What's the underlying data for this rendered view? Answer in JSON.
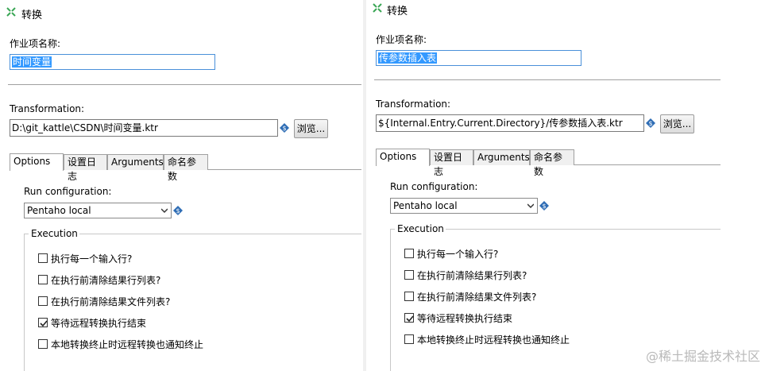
{
  "left": {
    "title": "转换",
    "job_name_label": "作业项名称:",
    "job_name_value": "时间变量",
    "transformation_label": "Transformation:",
    "transformation_path": "D:\\git_kattle\\CSDN\\时间变量.ktr",
    "browse_label": "浏览...",
    "tabs": [
      {
        "label": "Options",
        "active": true
      },
      {
        "label": "设置日志",
        "active": false
      },
      {
        "label": "Arguments",
        "active": false
      },
      {
        "label": "命名参数",
        "active": false
      }
    ],
    "run_config_label": "Run configuration:",
    "run_config_value": "Pentaho local",
    "execution_label": "Execution",
    "options": [
      {
        "label": "执行每一个输入行?",
        "checked": false
      },
      {
        "label": "在执行前清除结果行列表?",
        "checked": false
      },
      {
        "label": "在执行前清除结果文件列表?",
        "checked": false
      },
      {
        "label": "等待远程转换执行结束",
        "checked": true
      },
      {
        "label": "本地转换终止时远程转换也通知终止",
        "checked": false
      }
    ]
  },
  "right": {
    "title": "转换",
    "job_name_label": "作业项名称:",
    "job_name_value": "传参数插入表",
    "transformation_label": "Transformation:",
    "transformation_path": "${Internal.Entry.Current.Directory}/传参数插入表.ktr",
    "browse_label": "浏览...",
    "tabs": [
      {
        "label": "Options",
        "active": true
      },
      {
        "label": "设置日志",
        "active": false
      },
      {
        "label": "Arguments",
        "active": false
      },
      {
        "label": "命名参数",
        "active": false
      }
    ],
    "run_config_label": "Run configuration:",
    "run_config_value": "Pentaho local",
    "execution_label": "Execution",
    "options": [
      {
        "label": "执行每一个输入行?",
        "checked": false
      },
      {
        "label": "在执行前清除结果行列表?",
        "checked": false
      },
      {
        "label": "在执行前清除结果文件列表?",
        "checked": false
      },
      {
        "label": "等待远程转换执行结束",
        "checked": true
      },
      {
        "label": "本地转换终止时远程转换也通知终止",
        "checked": false
      }
    ]
  },
  "watermark": "@稀土掘金技术社区",
  "colors": {
    "selection": "#3399ff",
    "input_border": "#4a90d9",
    "variable_icon": "#2f6db5",
    "title_icon": "#3aa655"
  },
  "icons": {
    "title": "transformation-icon",
    "variable": "variable-diamond-icon",
    "dropdown": "chevron-down-icon",
    "check": "check-icon"
  }
}
